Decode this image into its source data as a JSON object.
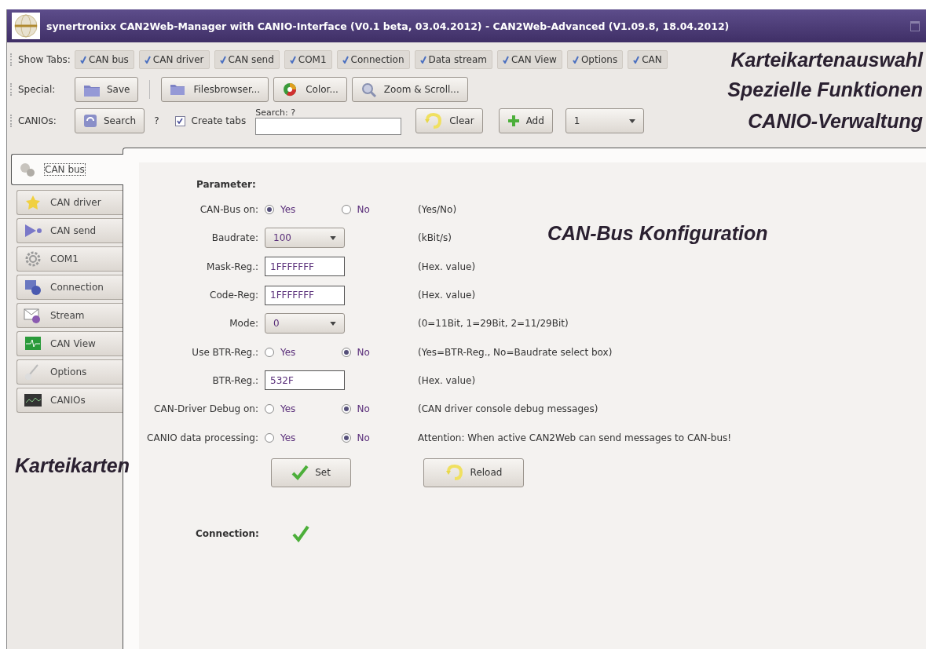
{
  "window": {
    "title": "synertronixx CAN2Web-Manager with CANIO-Interface (V0.1 beta, 03.04.2012) - CAN2Web-Advanced (V1.09.8, 18.04.2012)"
  },
  "toolbars": {
    "show_tabs": {
      "label": "Show Tabs:",
      "items": [
        {
          "label": "CAN bus",
          "checked": true
        },
        {
          "label": "CAN driver",
          "checked": true
        },
        {
          "label": "CAN send",
          "checked": true
        },
        {
          "label": "COM1",
          "checked": true
        },
        {
          "label": "Connection",
          "checked": true
        },
        {
          "label": "Data stream",
          "checked": true
        },
        {
          "label": "CAN View",
          "checked": true
        },
        {
          "label": "Options",
          "checked": true
        },
        {
          "label": "CAN",
          "checked": true
        }
      ]
    },
    "special": {
      "label": "Special:",
      "buttons": [
        "Save",
        "Filesbrowser...",
        "Color...",
        "Zoom & Scroll..."
      ]
    },
    "canios": {
      "label": "CANIOs:",
      "search_button": "Search",
      "status": "?",
      "create_tabs": {
        "label": "Create tabs",
        "checked": true
      },
      "search_field": {
        "label": "Search: ?"
      },
      "clear_button": "Clear",
      "add_button": "Add",
      "count_select": "1"
    }
  },
  "annotations": {
    "tab_selection": "Karteikartenauswahl",
    "special_functions": "Spezielle Funktionen",
    "canio_management": "CANIO-Verwaltung",
    "config": "CAN-Bus Konfiguration",
    "tabs": "Karteikarten"
  },
  "sidebar": {
    "items": [
      {
        "label": "CAN bus",
        "selected": true
      },
      {
        "label": "CAN driver",
        "selected": false
      },
      {
        "label": "CAN send",
        "selected": false
      },
      {
        "label": "COM1",
        "selected": false
      },
      {
        "label": "Connection",
        "selected": false
      },
      {
        "label": "Stream",
        "selected": false
      },
      {
        "label": "CAN View",
        "selected": false
      },
      {
        "label": "Options",
        "selected": false
      },
      {
        "label": "CANIOs",
        "selected": false
      }
    ]
  },
  "form": {
    "heading": "Parameter:",
    "rows": [
      {
        "kind": "radio",
        "label": "CAN-Bus on:",
        "options": [
          {
            "label": "Yes",
            "selected": true
          },
          {
            "label": "No",
            "selected": false
          }
        ],
        "note": "(Yes/No)"
      },
      {
        "kind": "select",
        "label": "Baudrate:",
        "value": "100",
        "note": "(kBit/s)"
      },
      {
        "kind": "text",
        "label": "Mask-Reg.:",
        "value": "1FFFFFFF",
        "note": "(Hex. value)"
      },
      {
        "kind": "text",
        "label": "Code-Reg:",
        "value": "1FFFFFFF",
        "note": "(Hex. value)"
      },
      {
        "kind": "select",
        "label": "Mode:",
        "value": "0",
        "note": "(0=11Bit, 1=29Bit, 2=11/29Bit)"
      },
      {
        "kind": "radio",
        "label": "Use BTR-Reg.:",
        "options": [
          {
            "label": "Yes",
            "selected": false
          },
          {
            "label": "No",
            "selected": true
          }
        ],
        "note": "(Yes=BTR-Reg., No=Baudrate select box)"
      },
      {
        "kind": "text",
        "label": "BTR-Reg.:",
        "value": "532F",
        "note": "(Hex. value)"
      },
      {
        "kind": "radio",
        "label": "CAN-Driver Debug on:",
        "options": [
          {
            "label": "Yes",
            "selected": false
          },
          {
            "label": "No",
            "selected": true
          }
        ],
        "note": "(CAN driver console debug messages)"
      },
      {
        "kind": "radio",
        "label": "CANIO data processing:",
        "options": [
          {
            "label": "Yes",
            "selected": false
          },
          {
            "label": "No",
            "selected": true
          }
        ],
        "note": "Attention: When active CAN2Web can send messages to CAN-bus!"
      }
    ],
    "set_button": "Set",
    "reload_button": "Reload",
    "connection": {
      "label": "Connection:",
      "ok": true
    }
  }
}
